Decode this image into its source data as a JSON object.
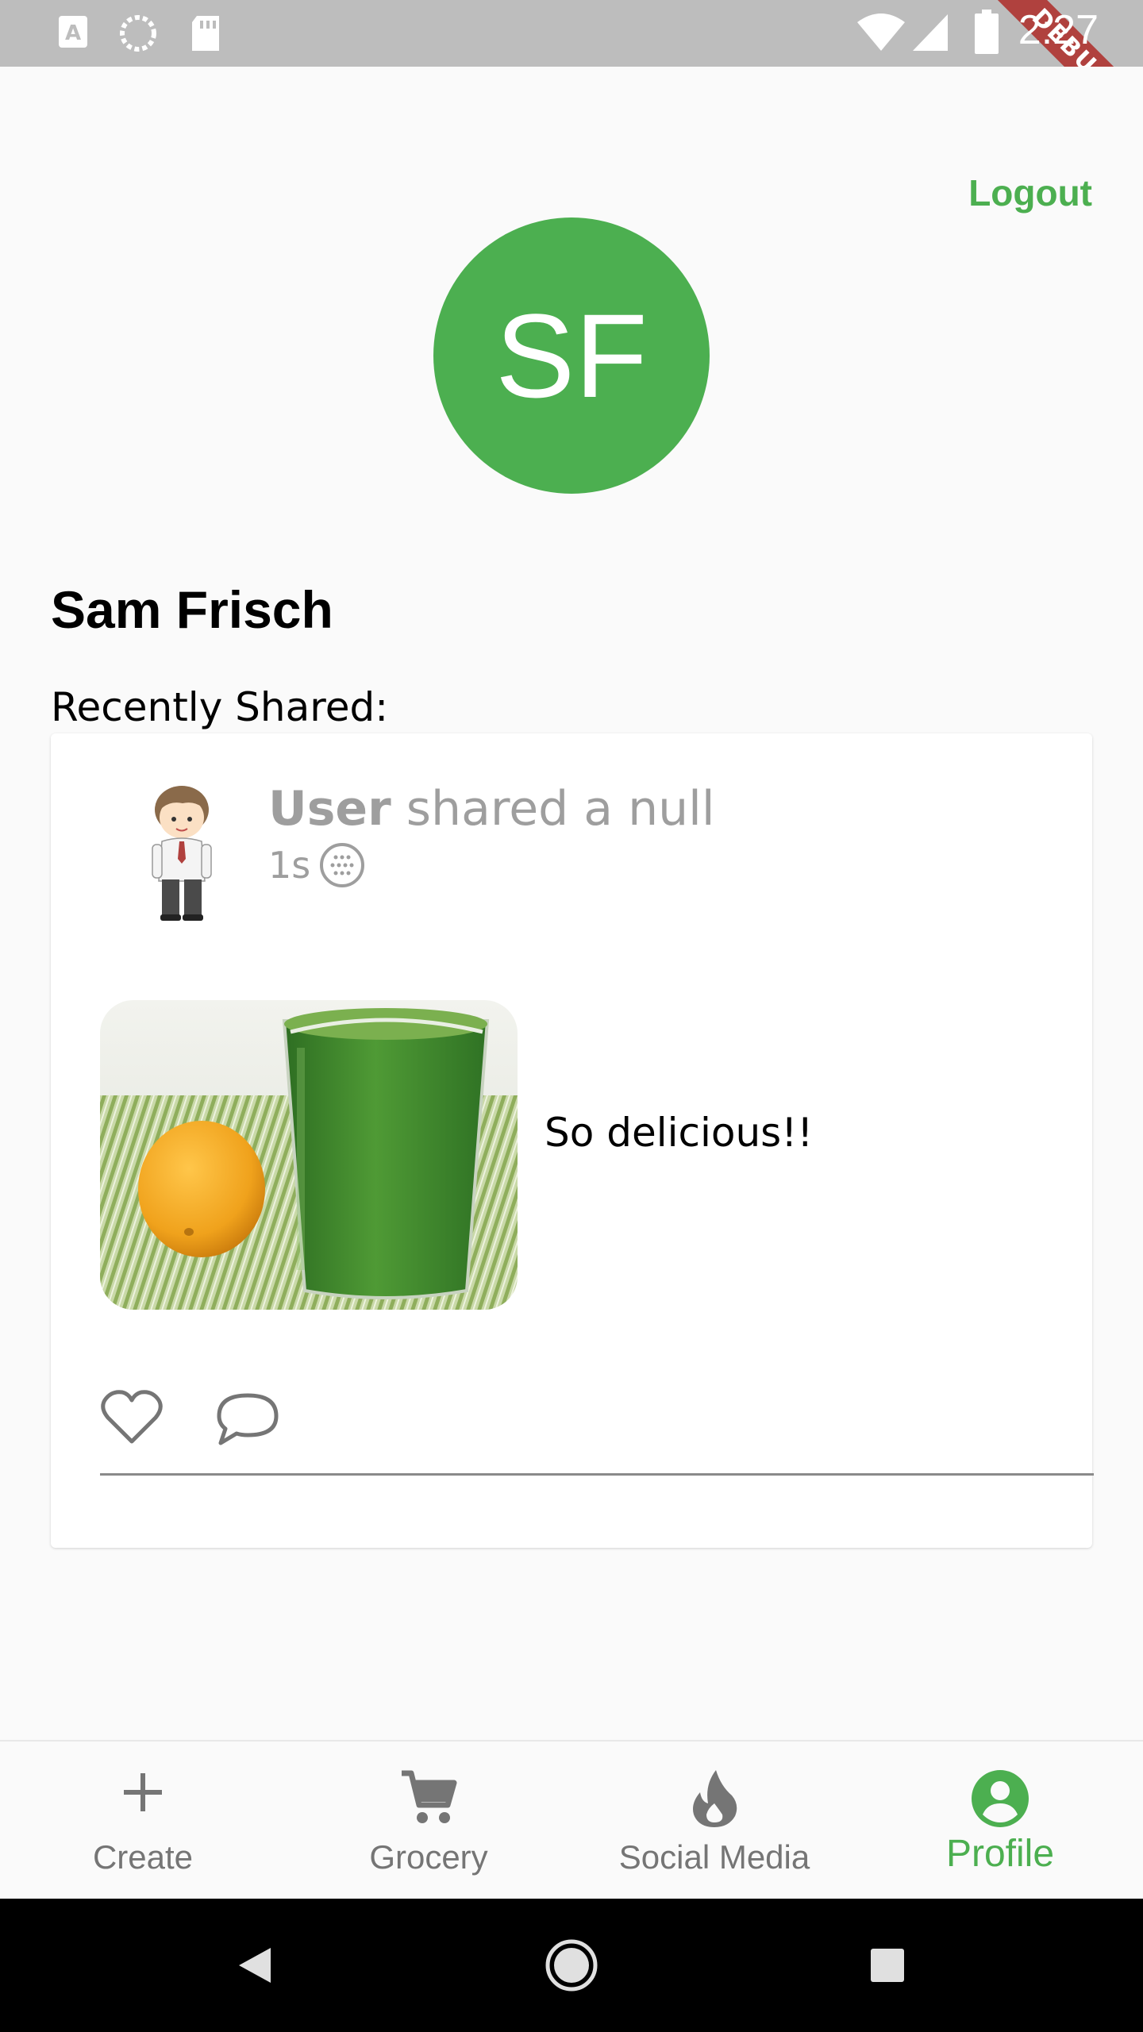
{
  "status_bar": {
    "time": "2:27",
    "debug_label": "DEBUG",
    "left_icons": [
      "a-notification-icon",
      "sync-icon",
      "sd-card-icon"
    ],
    "right_icons": [
      "wifi-icon",
      "cell-signal-icon",
      "battery-icon"
    ]
  },
  "header": {
    "logout_label": "Logout",
    "avatar_initials": "SF",
    "name": "Sam Frisch",
    "section_label": "Recently Shared:"
  },
  "post": {
    "user_label": "User",
    "shared_text": " shared a null",
    "time_ago": "1s",
    "visibility_icon": "globe-icon",
    "caption": "So delicious!!",
    "image_alt": "green juice and orange"
  },
  "bottom_nav": {
    "items": [
      {
        "label": "Create",
        "icon": "plus-icon"
      },
      {
        "label": "Grocery",
        "icon": "cart-icon"
      },
      {
        "label": "Social Media",
        "icon": "flame-icon"
      },
      {
        "label": "Profile",
        "icon": "account-circle-icon"
      }
    ],
    "active_index": 3
  },
  "colors": {
    "accent": "#4caf50",
    "status_bar": "#bdbdbd",
    "muted_text": "#9e9e9e",
    "nav_inactive": "#757575",
    "debug_banner": "#b0413e"
  }
}
